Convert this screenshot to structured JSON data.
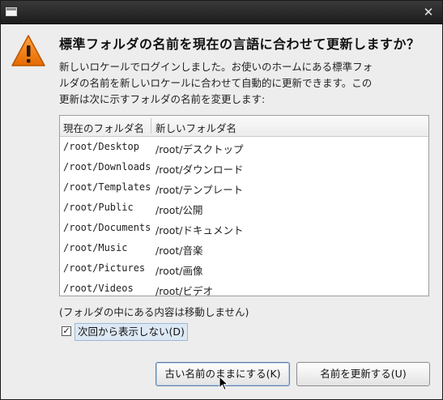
{
  "dialog": {
    "heading": "標準フォルダの名前を現在の言語に合わせて更新しますか？",
    "description_lines": [
      "新しいロケールでログインしました。お使いのホームにある標準フォ",
      "ルダの名前を新しいロケールに合わせて自動的に更新できます。この",
      "更新は次に示すフォルダの名前を変更します:"
    ],
    "table": {
      "headers": [
        "現在のフォルダ名",
        "新しいフォルダ名"
      ],
      "rows": [
        [
          "/root/Desktop",
          "/root/デスクトップ"
        ],
        [
          "/root/Downloads",
          "/root/ダウンロード"
        ],
        [
          "/root/Templates",
          "/root/テンプレート"
        ],
        [
          "/root/Public",
          "/root/公開"
        ],
        [
          "/root/Documents",
          "/root/ドキュメント"
        ],
        [
          "/root/Music",
          "/root/音楽"
        ],
        [
          "/root/Pictures",
          "/root/画像"
        ],
        [
          "/root/Videos",
          "/root/ビデオ"
        ]
      ]
    },
    "note": "(フォルダの中にある内容は移動しません)",
    "checkbox": {
      "label": "次回から表示しない(D)",
      "checked": true,
      "mark": "✓"
    },
    "buttons": {
      "keep": "古い名前のままにする(K)",
      "update": "名前を更新する(U)"
    }
  },
  "titlebar": {
    "close_glyph": "✕"
  },
  "icons": {
    "warning": "warning-icon",
    "close": "close-icon",
    "window": "window-icon"
  },
  "colors": {
    "warning_orange": "#f07a0e",
    "selection": "#dde8f5"
  }
}
